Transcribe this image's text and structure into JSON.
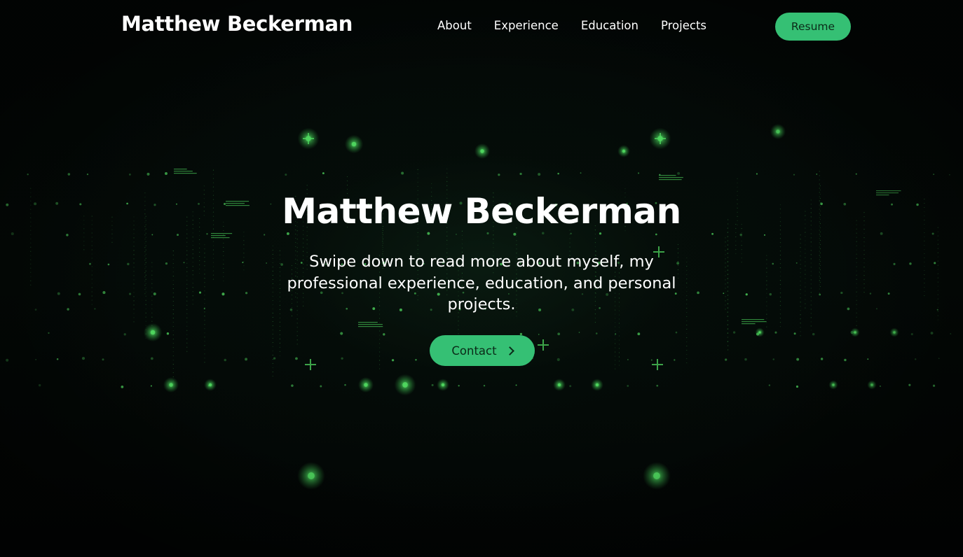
{
  "nav": {
    "brand": "Matthew Beckerman",
    "links": [
      {
        "label": "About"
      },
      {
        "label": "Experience"
      },
      {
        "label": "Education"
      },
      {
        "label": "Projects"
      }
    ],
    "resume_label": "Resume"
  },
  "hero": {
    "title": "Matthew Beckerman",
    "subtitle": "Swipe down to read more about myself, my professional experience, education, and personal projects.",
    "contact_label": "Contact",
    "contact_icon": "chevron-right-icon"
  },
  "colors": {
    "accent": "#35c074",
    "background": "#020504",
    "particle": "#4fd65e"
  }
}
